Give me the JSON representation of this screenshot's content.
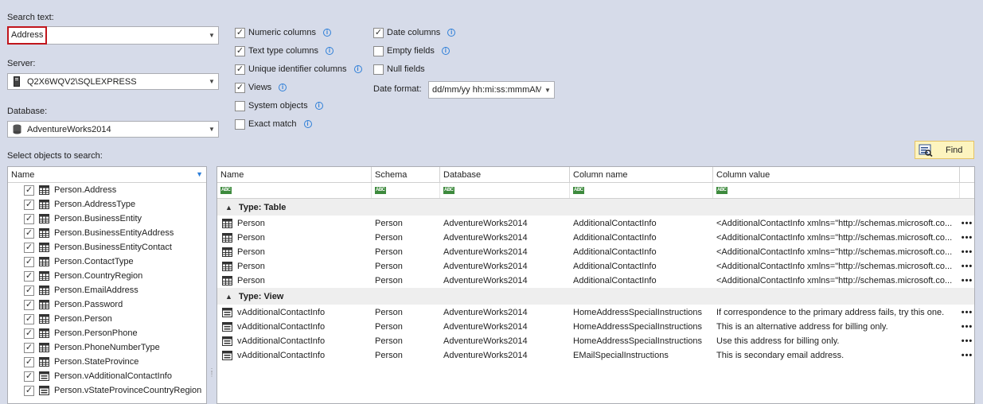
{
  "search": {
    "label": "Search text:",
    "value": "Address"
  },
  "server": {
    "label": "Server:",
    "value": "Q2X6WQV2\\SQLEXPRESS"
  },
  "database": {
    "label": "Database:",
    "value": "AdventureWorks2014"
  },
  "objects_label": "Select objects to search:",
  "options": {
    "numeric": "Numeric columns",
    "text": "Text type columns",
    "unique": "Unique identifier columns",
    "views": "Views",
    "system": "System objects",
    "exact": "Exact match",
    "date": "Date columns",
    "empty": "Empty fields",
    "null": "Null fields",
    "date_format_label": "Date format:",
    "date_format_value": "dd/mm/yy hh:mi:ss:mmmAM"
  },
  "find_label": "Find",
  "tree": {
    "header": "Name",
    "items": [
      "Person.Address",
      "Person.AddressType",
      "Person.BusinessEntity",
      "Person.BusinessEntityAddress",
      "Person.BusinessEntityContact",
      "Person.ContactType",
      "Person.CountryRegion",
      "Person.EmailAddress",
      "Person.Password",
      "Person.Person",
      "Person.PersonPhone",
      "Person.PhoneNumberType",
      "Person.StateProvince",
      "Person.vAdditionalContactInfo",
      "Person.vStateProvinceCountryRegion"
    ]
  },
  "grid": {
    "columns": [
      "Name",
      "Schema",
      "Database",
      "Column name",
      "Column value"
    ],
    "filter_glyph": "ABC",
    "more": "•••",
    "groups": [
      {
        "label": "Type: Table",
        "rows": [
          [
            "Person",
            "Person",
            "AdventureWorks2014",
            "AdditionalContactInfo",
            "<AdditionalContactInfo xmlns=\"http://schemas.microsoft.co..."
          ],
          [
            "Person",
            "Person",
            "AdventureWorks2014",
            "AdditionalContactInfo",
            "<AdditionalContactInfo xmlns=\"http://schemas.microsoft.co..."
          ],
          [
            "Person",
            "Person",
            "AdventureWorks2014",
            "AdditionalContactInfo",
            "<AdditionalContactInfo xmlns=\"http://schemas.microsoft.co..."
          ],
          [
            "Person",
            "Person",
            "AdventureWorks2014",
            "AdditionalContactInfo",
            "<AdditionalContactInfo xmlns=\"http://schemas.microsoft.co..."
          ],
          [
            "Person",
            "Person",
            "AdventureWorks2014",
            "AdditionalContactInfo",
            "<AdditionalContactInfo xmlns=\"http://schemas.microsoft.co..."
          ]
        ]
      },
      {
        "label": "Type: View",
        "rows": [
          [
            "vAdditionalContactInfo",
            "Person",
            "AdventureWorks2014",
            "HomeAddressSpecialInstructions",
            "If correspondence to the primary address fails, try this one."
          ],
          [
            "vAdditionalContactInfo",
            "Person",
            "AdventureWorks2014",
            "HomeAddressSpecialInstructions",
            "This is an alternative address for billing only."
          ],
          [
            "vAdditionalContactInfo",
            "Person",
            "AdventureWorks2014",
            "HomeAddressSpecialInstructions",
            "Use this address for billing only."
          ],
          [
            "vAdditionalContactInfo",
            "Person",
            "AdventureWorks2014",
            "EMailSpecialInstructions",
            "This is secondary email address."
          ]
        ]
      }
    ]
  }
}
